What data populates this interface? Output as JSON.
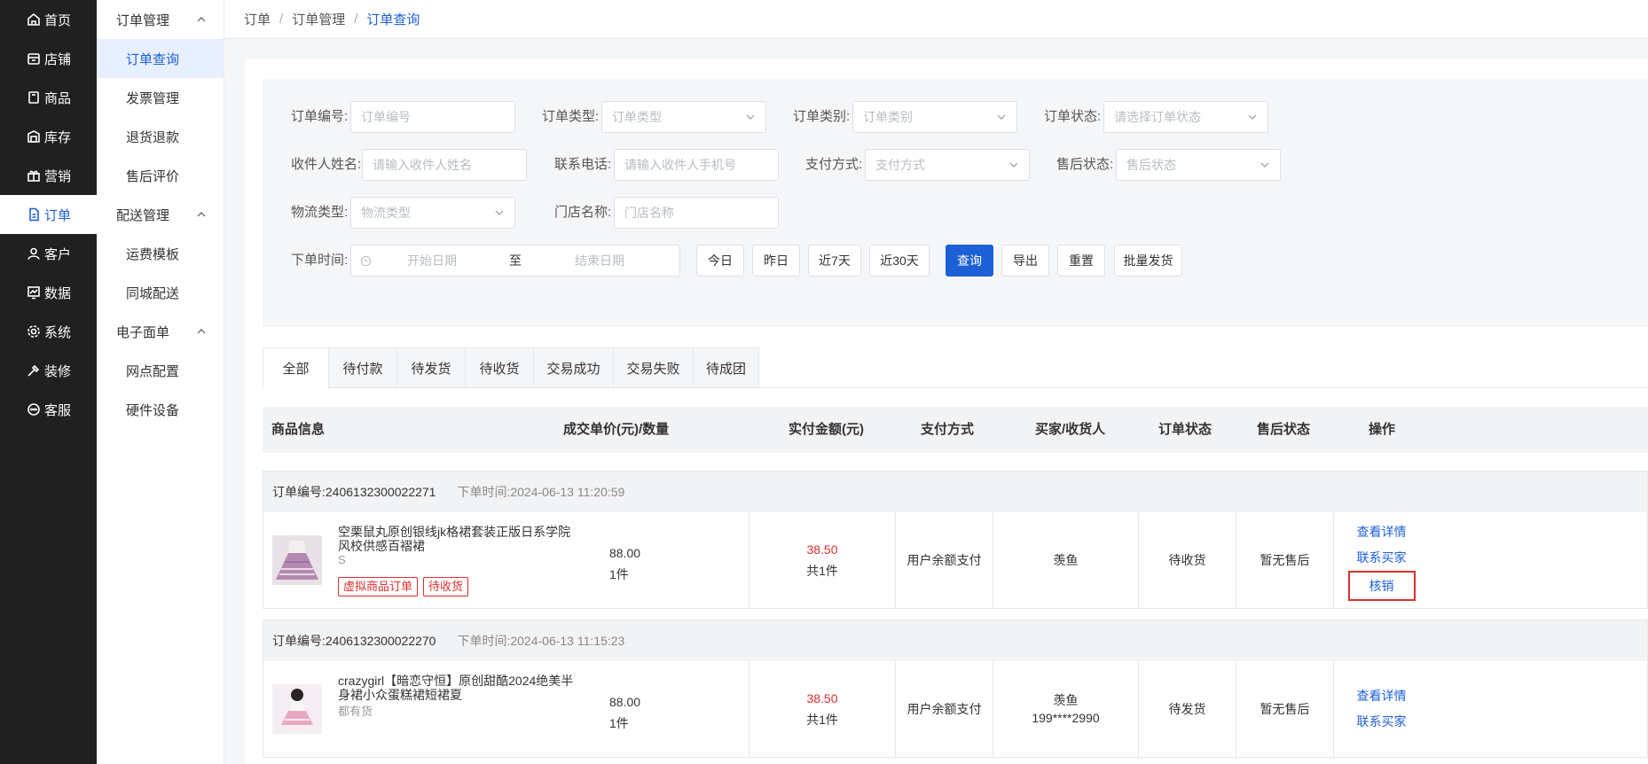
{
  "nav": {
    "items": [
      {
        "label": "首页",
        "icon": "home-icon"
      },
      {
        "label": "店铺",
        "icon": "store-icon"
      },
      {
        "label": "商品",
        "icon": "goods-icon"
      },
      {
        "label": "库存",
        "icon": "inventory-icon"
      },
      {
        "label": "营销",
        "icon": "gift-icon"
      },
      {
        "label": "订单",
        "icon": "document-icon"
      },
      {
        "label": "客户",
        "icon": "user-icon"
      },
      {
        "label": "数据",
        "icon": "chart-icon"
      },
      {
        "label": "系统",
        "icon": "gear-icon"
      },
      {
        "label": "装修",
        "icon": "decor-icon"
      },
      {
        "label": "客服",
        "icon": "chat-icon"
      }
    ],
    "active": "订单"
  },
  "subnav": {
    "groups": [
      {
        "title": "订单管理",
        "items": [
          "订单查询",
          "发票管理",
          "退货退款",
          "售后评价"
        ]
      },
      {
        "title": "配送管理",
        "items": [
          "运费模板",
          "同城配送"
        ]
      },
      {
        "title": "电子面单",
        "items": [
          "网点配置",
          "硬件设备"
        ]
      }
    ],
    "active": "订单查询"
  },
  "breadcrumb": [
    "订单",
    "订单管理",
    "订单查询"
  ],
  "filters": {
    "order_no": {
      "label": "订单编号:",
      "placeholder": "订单编号"
    },
    "order_type": {
      "label": "订单类型:",
      "placeholder": "订单类型"
    },
    "order_category": {
      "label": "订单类别:",
      "placeholder": "订单类别"
    },
    "order_status": {
      "label": "订单状态:",
      "placeholder": "请选择订单状态"
    },
    "receiver_name": {
      "label": "收件人姓名:",
      "placeholder": "请输入收件人姓名"
    },
    "phone": {
      "label": "联系电话:",
      "placeholder": "请输入收件人手机号"
    },
    "pay_method": {
      "label": "支付方式:",
      "placeholder": "支付方式"
    },
    "aftersale_status": {
      "label": "售后状态:",
      "placeholder": "售后状态"
    },
    "logistics_type": {
      "label": "物流类型:",
      "placeholder": "物流类型"
    },
    "store_name": {
      "label": "门店名称:",
      "placeholder": "门店名称"
    },
    "order_time": {
      "label": "下单时间:",
      "start": "开始日期",
      "to": "至",
      "end": "结束日期"
    }
  },
  "buttons": {
    "today": "今日",
    "yesterday": "昨日",
    "last7": "近7天",
    "last30": "近30天",
    "query": "查询",
    "export": "导出",
    "reset": "重置",
    "batch_ship": "批量发货"
  },
  "tabs": [
    "全部",
    "待付款",
    "待发货",
    "待收货",
    "交易成功",
    "交易失败",
    "待成团"
  ],
  "active_tab": "全部",
  "table_headers": {
    "goods": "商品信息",
    "price_qty": "成交单价(元)/数量",
    "paid": "实付金额(元)",
    "pay_method": "支付方式",
    "buyer": "买家/收货人",
    "status": "订单状态",
    "aftersale": "售后状态",
    "actions": "操作"
  },
  "orders": [
    {
      "no_label": "订单编号:2406132300022271",
      "time_label": "下单时间:2024-06-13 11:20:59",
      "name": "空栗鼠丸原创银线jk格裙套装正版日系学院风校供感百褶裙",
      "sku": "S",
      "tags": [
        "虚拟商品订单",
        "待收货"
      ],
      "unit_price": "88.00",
      "qty": "1件",
      "paid": "38.50",
      "paid_count": "共1件",
      "pay_method": "用户余额支付",
      "buyer": "羡鱼",
      "status": "待收货",
      "aftersale": "暂无售后",
      "actions": [
        "查看详情",
        "联系买家",
        "核销"
      ]
    },
    {
      "no_label": "订单编号:2406132300022270",
      "time_label": "下单时间:2024-06-13 11:15:23",
      "name": "crazygirl【暗恋守恒】原创甜酷2024绝美半身裙小众蛋糕裙短裙夏",
      "sku": "都有货",
      "unit_price": "88.00",
      "qty": "1件",
      "paid": "38.50",
      "paid_count": "共1件",
      "pay_method": "用户余额支付",
      "buyer": "羡鱼",
      "buyer_phone": "199****2990",
      "status": "待发货",
      "aftersale": "暂无售后",
      "actions": [
        "查看详情",
        "联系买家"
      ]
    }
  ],
  "colors": {
    "accent": "#1d5fd6",
    "danger": "#e02e2e",
    "sidebar": "#202020"
  }
}
